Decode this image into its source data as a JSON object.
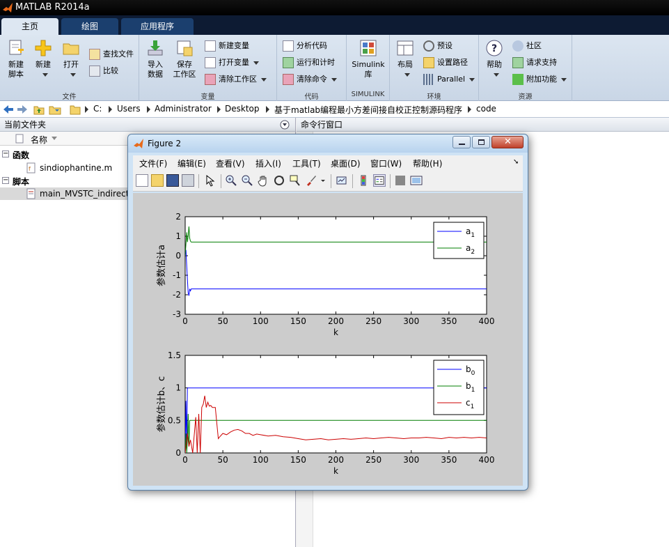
{
  "app": {
    "title": "MATLAB R2014a"
  },
  "tabs": [
    {
      "label": "主页"
    },
    {
      "label": "绘图"
    },
    {
      "label": "应用程序"
    }
  ],
  "ribbon": {
    "file_group": {
      "label": "文件",
      "new_script": [
        "新建",
        "脚本"
      ],
      "new": "新建",
      "open": "打开",
      "find_files": "查找文件",
      "compare": "比较"
    },
    "variable_group": {
      "label": "变量",
      "import": [
        "导入",
        "数据"
      ],
      "save": [
        "保存",
        "工作区"
      ],
      "new_var": "新建变量",
      "open_var": "打开变量",
      "clear_ws": "清除工作区"
    },
    "code_group": {
      "label": "代码",
      "analyze": "分析代码",
      "run_time": "运行和计时",
      "clear_cmd": "清除命令"
    },
    "simulink_group": {
      "label": "SIMULINK",
      "lib": [
        "Simulink",
        "库"
      ]
    },
    "env_group": {
      "label": "环境",
      "layout": "布局",
      "prefs": "预设",
      "set_path": "设置路径",
      "parallel": "Parallel"
    },
    "res_group": {
      "label": "资源",
      "help": "帮助",
      "community": "社区",
      "support": "请求支持",
      "addons": "附加功能"
    }
  },
  "address": {
    "parts": [
      "C:",
      "Users",
      "Administrator",
      "Desktop",
      "基于matlab编程最小方差间接自校正控制源码程序",
      "code"
    ]
  },
  "current_folder": {
    "title": "当前文件夹",
    "col_name": "名称",
    "sections": [
      {
        "label": "函数",
        "files": [
          "sindiophantine.m"
        ]
      },
      {
        "label": "脚本",
        "files": [
          "main_MVSTC_indirect.m"
        ]
      }
    ]
  },
  "command_window": {
    "title": "命令行窗口"
  },
  "figure": {
    "title": "Figure 2",
    "menu": [
      "文件(F)",
      "编辑(E)",
      "查看(V)",
      "插入(I)",
      "工具(T)",
      "桌面(D)",
      "窗口(W)",
      "帮助(H)"
    ]
  },
  "chart_data": [
    {
      "type": "line",
      "xlabel": "k",
      "ylabel": "参数估计a",
      "xlim": [
        0,
        400
      ],
      "ylim": [
        -3,
        2
      ],
      "xticks": [
        0,
        50,
        100,
        150,
        200,
        250,
        300,
        350,
        400
      ],
      "yticks": [
        -3,
        -2,
        -1,
        0,
        1,
        2
      ],
      "legend_position": "top-right",
      "series": [
        {
          "name": "a",
          "sub": "1",
          "color": "#0000ff",
          "x": [
            0,
            1,
            2,
            3,
            4,
            5,
            6,
            7,
            8,
            9,
            10,
            400
          ],
          "y": [
            0,
            0.3,
            -0.5,
            -1.2,
            -1.9,
            -2.05,
            -1.7,
            -1.8,
            -1.7,
            -1.7,
            -1.7,
            -1.7
          ]
        },
        {
          "name": "a",
          "sub": "2",
          "color": "#007f00",
          "x": [
            0,
            1,
            2,
            3,
            4,
            5,
            6,
            7,
            8,
            9,
            10,
            400
          ],
          "y": [
            0,
            0.6,
            1.2,
            0.7,
            1.0,
            1.5,
            0.9,
            0.75,
            0.7,
            0.7,
            0.7,
            0.7
          ]
        }
      ]
    },
    {
      "type": "line",
      "xlabel": "k",
      "ylabel": "参数估计b、c",
      "xlim": [
        0,
        400
      ],
      "ylim": [
        0,
        1.5
      ],
      "xticks": [
        0,
        50,
        100,
        150,
        200,
        250,
        300,
        350,
        400
      ],
      "yticks": [
        0,
        0.5,
        1,
        1.5
      ],
      "legend_position": "top-right",
      "series": [
        {
          "name": "b",
          "sub": "0",
          "color": "#0000ff",
          "x": [
            0,
            1,
            2,
            3,
            4,
            5,
            400
          ],
          "y": [
            0,
            0.8,
            0.1,
            1.0,
            1.0,
            1.0,
            1.0
          ]
        },
        {
          "name": "b",
          "sub": "1",
          "color": "#007f00",
          "x": [
            0,
            1,
            2,
            3,
            4,
            5,
            6,
            7,
            400
          ],
          "y": [
            0,
            0.3,
            0.0,
            0.2,
            0.6,
            0.1,
            0.5,
            0.5,
            0.5
          ]
        },
        {
          "name": "c",
          "sub": "1",
          "color": "#cc0000",
          "x": [
            0,
            3,
            5,
            7,
            10,
            14,
            16,
            18,
            20,
            22,
            24,
            26,
            28,
            30,
            32,
            34,
            36,
            38,
            40,
            42,
            44,
            46,
            50,
            55,
            60,
            65,
            70,
            75,
            80,
            85,
            90,
            95,
            100,
            110,
            120,
            130,
            140,
            150,
            160,
            170,
            180,
            190,
            200,
            210,
            220,
            230,
            240,
            250,
            260,
            270,
            280,
            290,
            300,
            310,
            320,
            330,
            340,
            350,
            360,
            370,
            380,
            390,
            400
          ],
          "y": [
            0,
            0.3,
            0.1,
            0.2,
            0.0,
            0.55,
            0.0,
            0.6,
            0.0,
            0.7,
            0.75,
            0.88,
            0.7,
            0.78,
            0.72,
            0.73,
            0.7,
            0.7,
            0.7,
            0.45,
            0.22,
            0.25,
            0.3,
            0.28,
            0.32,
            0.35,
            0.36,
            0.34,
            0.3,
            0.3,
            0.27,
            0.29,
            0.28,
            0.26,
            0.27,
            0.25,
            0.24,
            0.22,
            0.2,
            0.21,
            0.22,
            0.2,
            0.21,
            0.22,
            0.21,
            0.22,
            0.23,
            0.22,
            0.23,
            0.24,
            0.23,
            0.22,
            0.23,
            0.23,
            0.24,
            0.23,
            0.22,
            0.24,
            0.23,
            0.24,
            0.23,
            0.24,
            0.23
          ]
        }
      ]
    }
  ]
}
